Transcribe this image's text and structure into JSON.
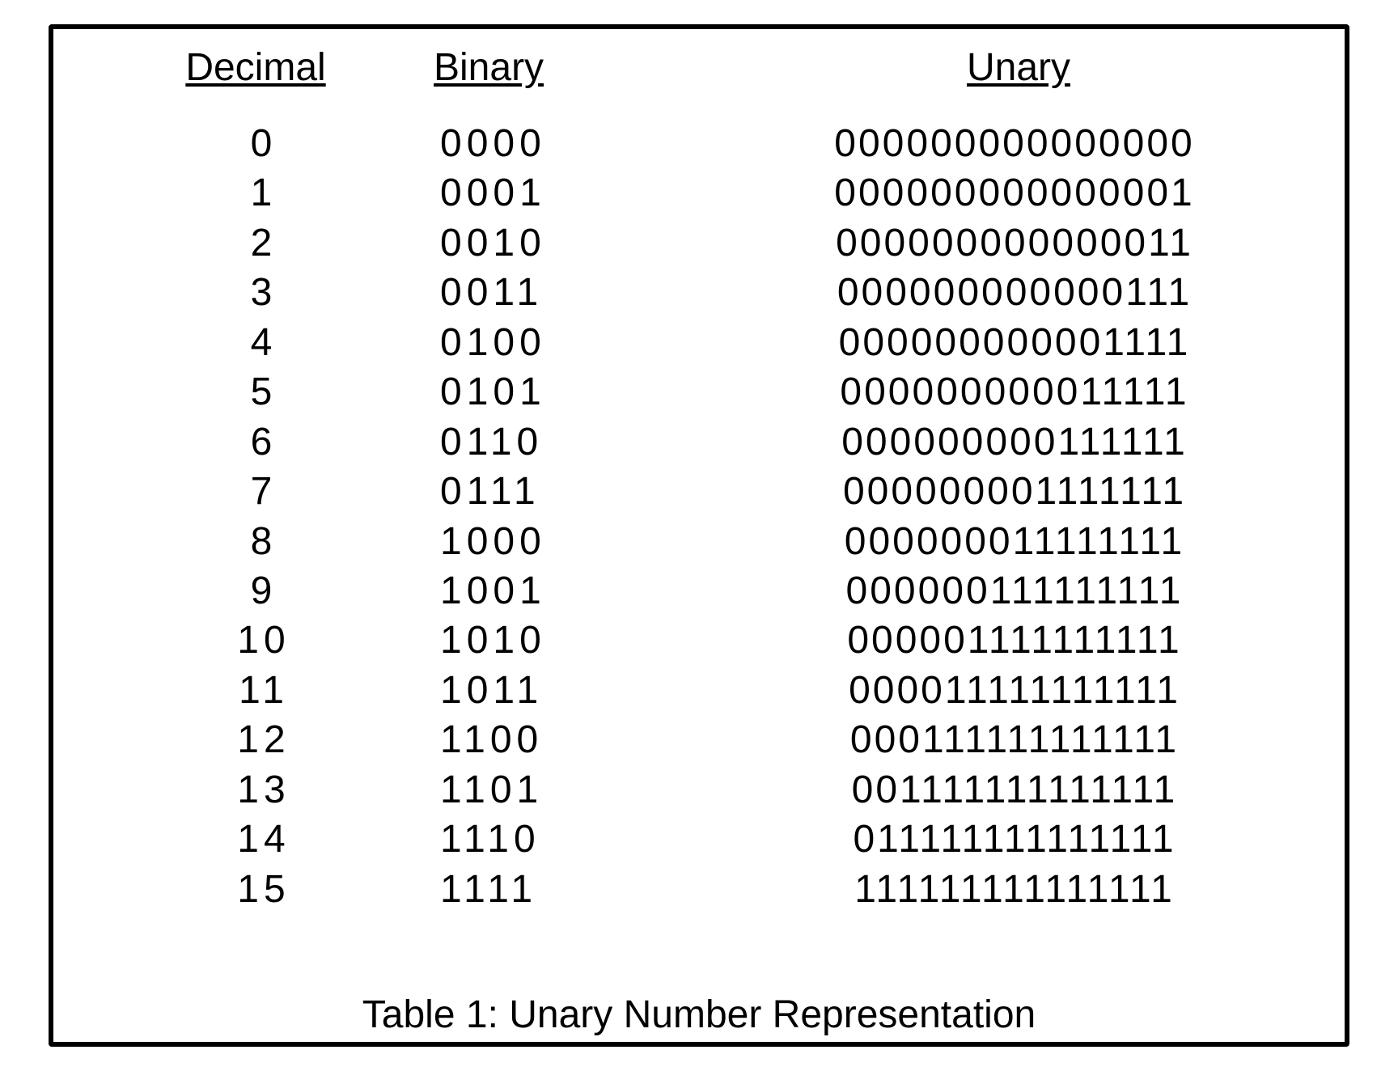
{
  "chart_data": {
    "type": "table",
    "title": "Table 1: Unary Number Representation",
    "columns": [
      "Decimal",
      "Binary",
      "Unary"
    ],
    "rows": [
      {
        "decimal": "0",
        "binary": "0000",
        "unary": "000000000000000"
      },
      {
        "decimal": "1",
        "binary": "0001",
        "unary": "000000000000001"
      },
      {
        "decimal": "2",
        "binary": "0010",
        "unary": "000000000000011"
      },
      {
        "decimal": "3",
        "binary": "0011",
        "unary": "000000000000111"
      },
      {
        "decimal": "4",
        "binary": "0100",
        "unary": "000000000001111"
      },
      {
        "decimal": "5",
        "binary": "0101",
        "unary": "000000000011111"
      },
      {
        "decimal": "6",
        "binary": "0110",
        "unary": "000000000111111"
      },
      {
        "decimal": "7",
        "binary": "0111",
        "unary": "000000001111111"
      },
      {
        "decimal": "8",
        "binary": "1000",
        "unary": "000000011111111"
      },
      {
        "decimal": "9",
        "binary": "1001",
        "unary": "000000111111111"
      },
      {
        "decimal": "10",
        "binary": "1010",
        "unary": "000001111111111"
      },
      {
        "decimal": "11",
        "binary": "1011",
        "unary": "000011111111111"
      },
      {
        "decimal": "12",
        "binary": "1100",
        "unary": "000111111111111"
      },
      {
        "decimal": "13",
        "binary": "1101",
        "unary": "001111111111111"
      },
      {
        "decimal": "14",
        "binary": "1110",
        "unary": "011111111111111"
      },
      {
        "decimal": "15",
        "binary": "1111",
        "unary": "111111111111111"
      }
    ]
  },
  "headers": {
    "decimal": "Decimal",
    "binary": "Binary",
    "unary": "Unary"
  },
  "caption": "Table 1: Unary Number Representation"
}
